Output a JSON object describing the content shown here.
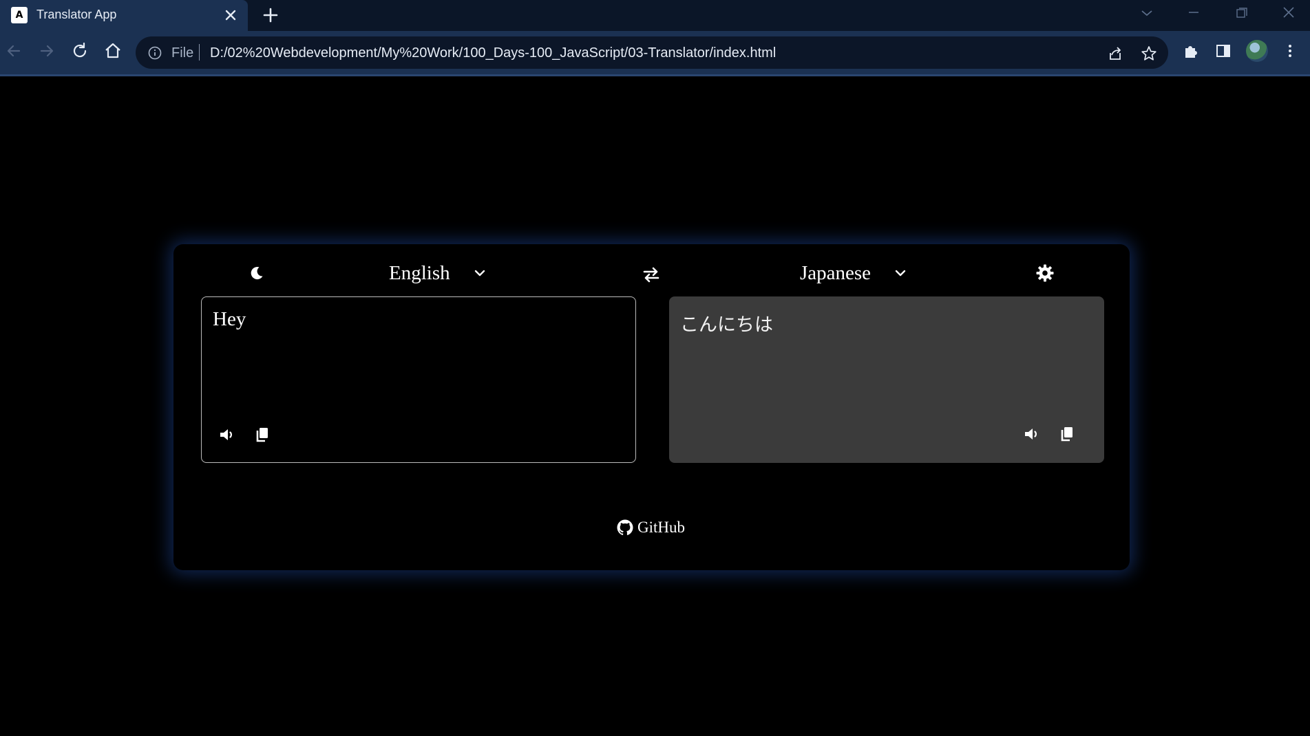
{
  "browser": {
    "tab_title": "Translator App",
    "favicon_text": "A",
    "omnibox": {
      "scheme_label": "File",
      "url": "D:/02%20Webdevelopment/My%20Work/100_Days-100_JavaScript/03-Translator/index.html"
    }
  },
  "translator": {
    "from_language": "English",
    "to_language": "Japanese",
    "input_text": "Hey",
    "output_text": "こんにちは",
    "footer_link": "GitHub"
  },
  "colors": {
    "page_bg": "#000000",
    "card_glow": "#1e4696",
    "output_box_bg": "#3b3b3b",
    "chrome_toolbar": "#1b3152"
  },
  "icons": {
    "theme": "moon-icon",
    "swap": "swap-arrows-icon",
    "settings": "gear-icon",
    "speak": "speaker-icon",
    "copy": "copy-icon",
    "github": "github-icon"
  }
}
